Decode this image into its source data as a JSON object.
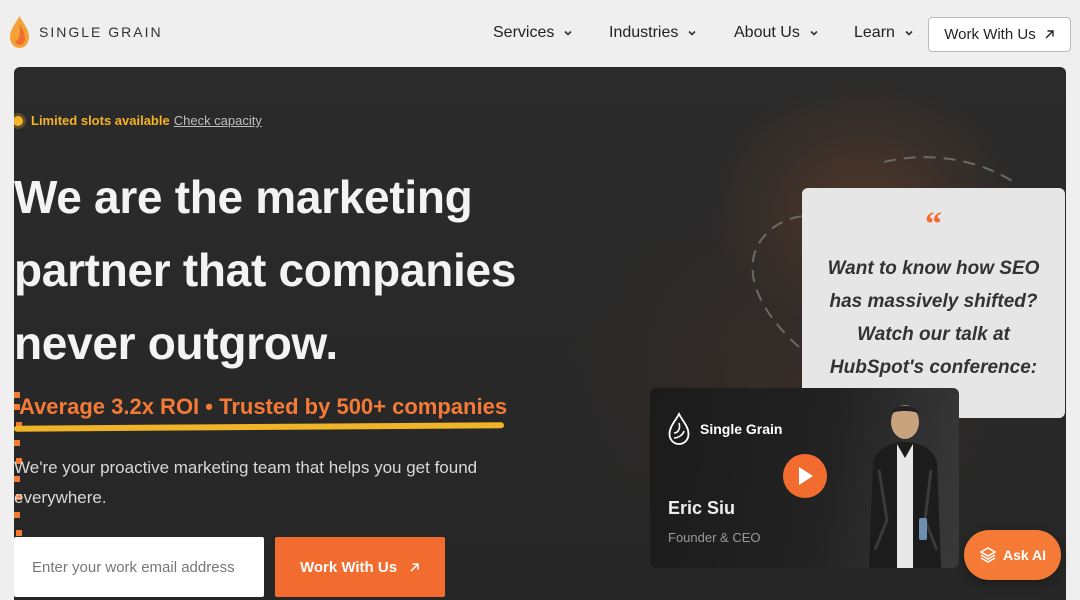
{
  "brand": {
    "name": "SINGLE GRAIN",
    "icon": "grain-drop-icon",
    "accent": "#f26b2f",
    "highlight": "#f5b326"
  },
  "nav": {
    "items": [
      {
        "label": "Services"
      },
      {
        "label": "Industries"
      },
      {
        "label": "About Us"
      },
      {
        "label": "Learn"
      }
    ],
    "cta_label": "Work With Us"
  },
  "hero": {
    "slots_label": "Limited slots available",
    "slots_link": "Check capacity",
    "headline_lines": [
      "We are the marketing",
      "partner that companies",
      "never outgrow."
    ],
    "roi_text": "Average 3.2x ROI • Trusted by 500+ companies",
    "subcopy": "We're your proactive marketing team that helps you get found everywhere.",
    "email_placeholder": "Enter your work email address",
    "cta_label": "Work With Us"
  },
  "quote": {
    "mark": "“",
    "text_lines": [
      "Want to know how SEO",
      "has massively shifted?",
      "Watch our talk at",
      "HubSpot's conference:"
    ]
  },
  "video": {
    "brand": "Single Grain",
    "name": "Eric Siu",
    "role": "Founder & CEO"
  },
  "ask_ai": {
    "label": "Ask AI"
  }
}
